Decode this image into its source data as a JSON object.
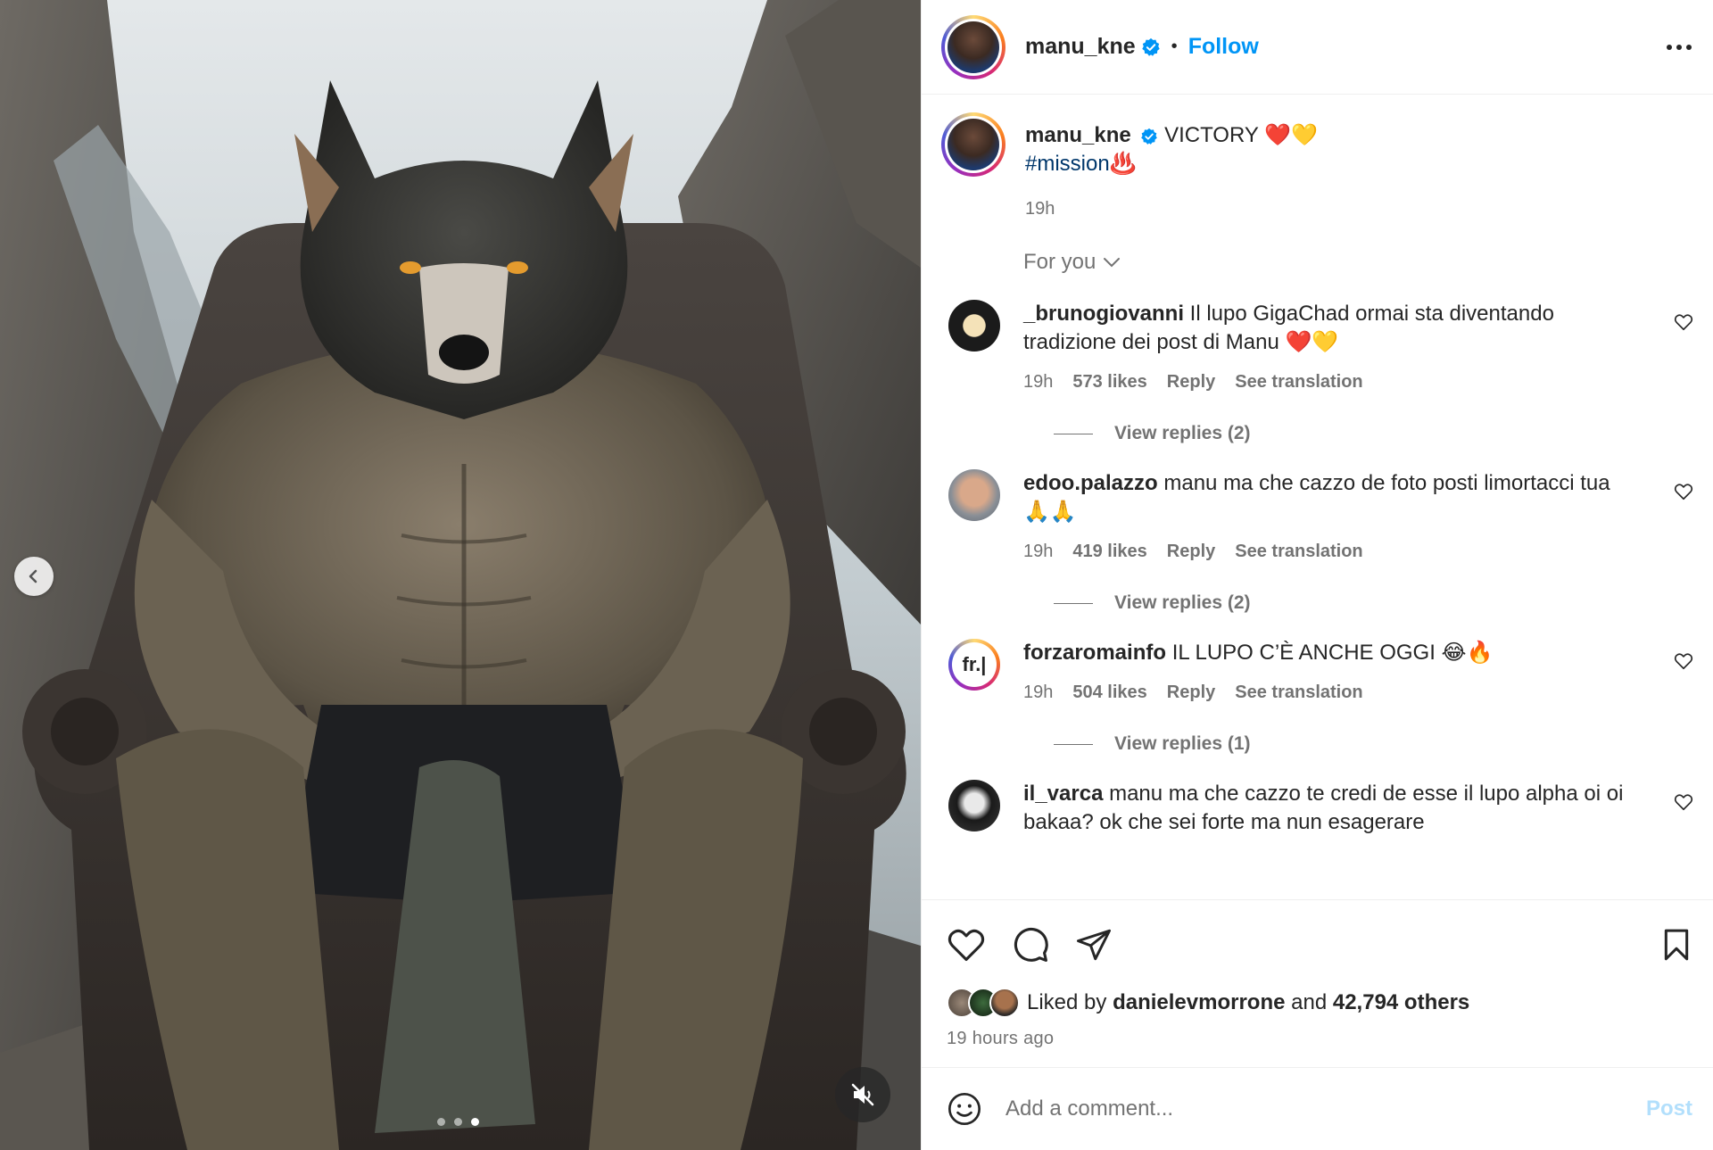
{
  "media": {
    "slide_count": 3,
    "active_slide": 3
  },
  "header": {
    "username": "manu_kne",
    "separator": "•",
    "follow_label": "Follow"
  },
  "caption": {
    "username": "manu_kne",
    "text": "VICTORY ❤️💛",
    "hashtag": "#mission♨️",
    "time": "19h"
  },
  "sort": {
    "label": "For you"
  },
  "comments": [
    {
      "username": "_brunogiovanni",
      "text": "Il lupo GigaChad ormai sta diventando tradizione dei post di Manu ❤️💛",
      "time": "19h",
      "likes": "573 likes",
      "reply": "Reply",
      "translate": "See translation",
      "replies": "View replies (2)"
    },
    {
      "username": "edoo.palazzo",
      "text": "manu ma che cazzo de foto posti limortacci tua 🙏🙏",
      "time": "19h",
      "likes": "419 likes",
      "reply": "Reply",
      "translate": "See translation",
      "replies": "View replies (2)"
    },
    {
      "username": "forzaromainfo",
      "text": "IL LUPO C’È ANCHE OGGI 😂🔥",
      "time": "19h",
      "likes": "504 likes",
      "reply": "Reply",
      "translate": "See translation",
      "replies": "View replies (1)"
    },
    {
      "username": "il_varca",
      "text": "manu ma che cazzo te credi de esse il lupo alpha oi oi bakaa? ok che sei forte ma nun esagerare"
    }
  ],
  "likes": {
    "prefix": "Liked by",
    "liker": "danielevmorrone",
    "and": "and",
    "others": "42,794 others"
  },
  "post_time": "19 hours ago",
  "composer": {
    "placeholder": "Add a comment...",
    "post_label": "Post"
  },
  "icons": {
    "verified": "verified-badge-icon",
    "prev": "chevron-left-icon",
    "mute": "speaker-muted-icon",
    "more": "more-options-icon"
  },
  "colors": {
    "accent": "#0095f6",
    "hashtag": "#00376b",
    "muted_text": "#737373",
    "post_disabled": "#b2dffc"
  }
}
